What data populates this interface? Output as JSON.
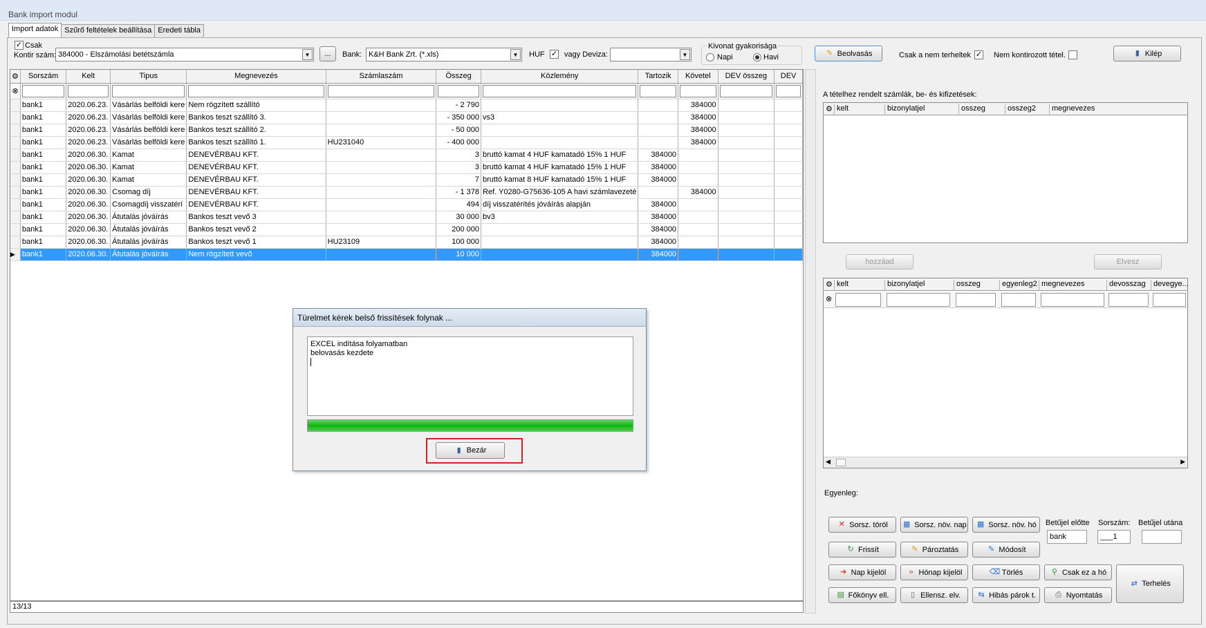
{
  "window": {
    "title": "Bank import modul"
  },
  "tabs": [
    "Import adatok",
    "Szűrő feltételek beállítása",
    "Eredeti tábla"
  ],
  "toolbar": {
    "csak_label": "Csak",
    "kontir_label": "Kontir szám:",
    "kontir_value": "384000 - Elszámolási betétszámla",
    "ellipsis": "...",
    "bank_label": "Bank:",
    "bank_value": "K&H Bank Zrt. (*.xls)",
    "huf_label": "HUF",
    "deviza_label": "vagy Deviza:",
    "deviza_value": "",
    "kivonat_label": "Kivonat gyakorisága",
    "napi_label": "Napi",
    "havi_label": "Havi",
    "beolvasas": "Beolvasás",
    "csak_nem_terheltek": "Csak a nem terheltek",
    "nem_kontirozott": "Nem kontirozott tétel.",
    "kilep": "Kilép"
  },
  "grid": {
    "columns": [
      "Sorszám",
      "Kelt",
      "Tipus",
      "Megnevezés",
      "Számlaszám",
      "Összeg",
      "Közlemény",
      "Tartozik",
      "Követel",
      "DEV összeg",
      "DEV"
    ],
    "rows": [
      [
        "bank1",
        "2020.06.23.",
        "Vásárlás belföldi kere",
        "Nem rögzített szállító",
        "",
        "- 2 790",
        "",
        "",
        "384000",
        "",
        ""
      ],
      [
        "bank1",
        "2020.06.23.",
        "Vásárlás belföldi kere",
        "Bankos teszt szállító 3.",
        "",
        "- 350 000",
        "vs3",
        "",
        "384000",
        "",
        ""
      ],
      [
        "bank1",
        "2020.06.23.",
        "Vásárlás belföldi kere",
        "Bankos teszt szállító 2.",
        "",
        "- 50 000",
        "",
        "",
        "384000",
        "",
        ""
      ],
      [
        "bank1",
        "2020.06.23.",
        "Vásárlás belföldi kere",
        "Bankos teszt szállító 1.",
        "HU231040",
        "- 400 000",
        "",
        "",
        "384000",
        "",
        ""
      ],
      [
        "bank1",
        "2020.06.30.",
        "Kamat",
        "DENEVÉRBAU KFT.",
        "",
        "3",
        "bruttó kamat 4 HUF kamatadó 15% 1 HUF",
        "384000",
        "",
        "",
        ""
      ],
      [
        "bank1",
        "2020.06.30.",
        "Kamat",
        "DENEVÉRBAU KFT.",
        "",
        "3",
        "bruttó kamat 4 HUF kamatadó 15% 1 HUF",
        "384000",
        "",
        "",
        ""
      ],
      [
        "bank1",
        "2020.06.30.",
        "Kamat",
        "DENEVÉRBAU KFT.",
        "",
        "7",
        "bruttó kamat 8 HUF kamatadó 15% 1 HUF",
        "384000",
        "",
        "",
        ""
      ],
      [
        "bank1",
        "2020.06.30.",
        "Csomag díj",
        "DENEVÉRBAU KFT.",
        "",
        "- 1 378",
        "Ref. Y0280-G75636-105 A havi számlavezeté",
        "",
        "384000",
        "",
        ""
      ],
      [
        "bank1",
        "2020.06.30.",
        "Csomagdíj visszatérí",
        "DENEVÉRBAU KFT.",
        "",
        "494",
        "díj visszatérítés jóváírás alapján",
        "384000",
        "",
        "",
        ""
      ],
      [
        "bank1",
        "2020.06.30.",
        "Átutalás jóváírás",
        "Bankos teszt vevő 3",
        "",
        "30 000",
        "bv3",
        "384000",
        "",
        "",
        ""
      ],
      [
        "bank1",
        "2020.06.30.",
        "Átutalás jóváírás",
        "Bankos teszt vevő 2",
        "",
        "200 000",
        "",
        "384000",
        "",
        "",
        ""
      ],
      [
        "bank1",
        "2020.06.30.",
        "Átutalás jóváírás",
        "Bankos teszt vevő 1",
        "HU23109",
        "100 000",
        "",
        "384000",
        "",
        "",
        ""
      ],
      [
        "bank1",
        "2020.06.30.",
        "Átutalás jóváírás",
        "Nem rögzített vevő",
        "",
        "10 000",
        "",
        "384000",
        "",
        "",
        ""
      ]
    ],
    "status": "13/13"
  },
  "right": {
    "title": "A tételhez rendelt számlák, be- és kifizetések:",
    "grid1_columns": [
      "kelt",
      "bizonylatjel",
      "osszeg",
      "osszeg2",
      "megnevezes"
    ],
    "hozzaad": "hozzáad",
    "elvesz": "Elvesz",
    "grid2_columns": [
      "kelt",
      "bizonylatjel",
      "osszeg",
      "egyenleg2",
      "megnevezes",
      "devosszag",
      "devegye..."
    ],
    "egyenleg_label": "Egyenleg:",
    "buttons": {
      "sorsz_torol": "Sorsz. töröl",
      "sorsz_nov_nap": "Sorsz. növ. nap",
      "sorsz_nov_ho": "Sorsz. növ. hó",
      "frissit": "Frissít",
      "paroztatas": "Pároztatás",
      "modosit": "Módosít",
      "nap_kijelol": "Nap kijelöl",
      "honap_kijelol": "Hónap kijelöl",
      "torles": "Törlés",
      "csak_ez_a_ho": "Csak ez a hó",
      "terheles": "Terhelés",
      "fokonyv_ell": "Főkönyv ell.",
      "ellensz_elv": "Ellensz. elv.",
      "hibas_parok": "Hibás párok t.",
      "nyomtatas": "Nyomtatás"
    },
    "betujel_elotte_label": "Betűjel előtte",
    "betujel_elotte_value": "bank",
    "sorszam_label": "Sorszám:",
    "sorszam_value": "___1",
    "betujel_utana_label": "Betűjel utána",
    "betujel_utana_value": ""
  },
  "dialog": {
    "title": "Türelmet kérek belső frissítések folynak ...",
    "line1": "EXCEL indítása folyamatban",
    "line2": "belovasás kezdete",
    "progress": 1.0,
    "close": "Bezár"
  }
}
